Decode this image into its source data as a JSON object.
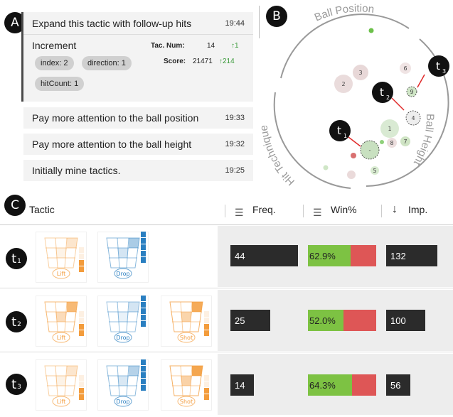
{
  "labels": {
    "a": "A",
    "b": "B",
    "c": "C"
  },
  "history": {
    "items": [
      {
        "text": "Expand this tactic with follow-up hits",
        "time": "19:44"
      },
      {
        "text": "Pay more attention to the ball position",
        "time": "19:33"
      },
      {
        "text": "Pay more attention to the ball height",
        "time": "19:32"
      },
      {
        "text": "Initially mine tactics.",
        "time": "19:25"
      }
    ],
    "detail": {
      "title": "Increment",
      "tac_num_label": "Tac. Num:",
      "tac_num_value": "14",
      "tac_num_delta": "↑1",
      "score_label": "Score:",
      "score_value": "21471",
      "score_delta": "↑214",
      "params": [
        "index: 2",
        "direction: 1",
        "hitCount: 1"
      ]
    }
  },
  "radial": {
    "axes": [
      "Ball Position",
      "Ball Height",
      "Hit Technique"
    ],
    "tactic_labels": [
      "t",
      "t",
      "t"
    ],
    "tactic_subs": [
      "1",
      "2",
      "3"
    ],
    "nodes": [
      {
        "label": "3",
        "color": "#e8d8d8"
      },
      {
        "label": "2",
        "color": "#eadcdc"
      },
      {
        "label": "6",
        "color": "#f0e4e4"
      },
      {
        "label": "9",
        "color": "#cfe6c6"
      },
      {
        "label": "4",
        "color": "#eeeeee"
      },
      {
        "label": "1",
        "color": "#d9ead3"
      },
      {
        "label": "8",
        "color": "#ecdede"
      },
      {
        "label": "7",
        "color": "#cfe4c4"
      },
      {
        "label": "-",
        "color": "#c8e0c0"
      },
      {
        "label": "5",
        "color": "#d8ebd0"
      }
    ]
  },
  "table": {
    "headers": {
      "tactic": "Tactic",
      "freq": "Freq.",
      "win": "Win%",
      "imp": "Imp."
    },
    "rows": [
      {
        "t": "t",
        "sub": "1",
        "freq": "44",
        "freq_frac": 0.99,
        "win": "62.9%",
        "win_frac": 0.629,
        "imp": "132",
        "imp_frac": 0.95,
        "thumbs": [
          {
            "label": "Lift",
            "color": "#f39c3c"
          },
          {
            "label": "Drop",
            "color": "#2a7fc1"
          }
        ]
      },
      {
        "t": "t",
        "sub": "2",
        "freq": "25",
        "freq_frac": 0.58,
        "win": "52.0%",
        "win_frac": 0.52,
        "imp": "100",
        "imp_frac": 0.72,
        "thumbs": [
          {
            "label": "Lift",
            "color": "#f39c3c"
          },
          {
            "label": "Drop",
            "color": "#2a7fc1"
          },
          {
            "label": "Shot",
            "color": "#f39c3c"
          }
        ]
      },
      {
        "t": "t",
        "sub": "3",
        "freq": "14",
        "freq_frac": 0.34,
        "win": "64.3%",
        "win_frac": 0.643,
        "imp": "56",
        "imp_frac": 0.45,
        "thumbs": [
          {
            "label": "Lift",
            "color": "#f39c3c"
          },
          {
            "label": "Drop",
            "color": "#2a7fc1"
          },
          {
            "label": "Shot",
            "color": "#f39c3c"
          }
        ]
      }
    ]
  },
  "colors": {
    "green": "#7dc243",
    "red": "#de5656",
    "dark": "#2b2b2b",
    "orange": "#f39c3c",
    "blue": "#2a7fc1"
  }
}
